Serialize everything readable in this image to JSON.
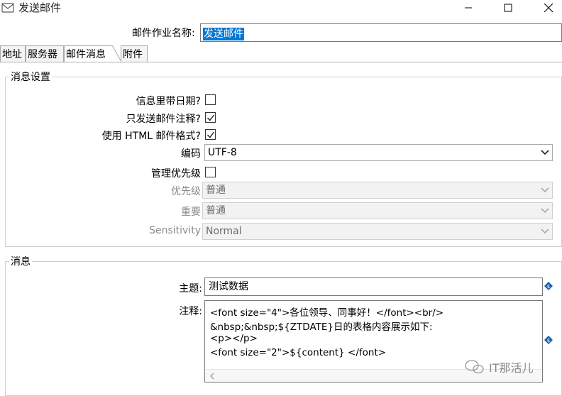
{
  "window": {
    "title": "发送邮件"
  },
  "job": {
    "label": "邮件作业名称:",
    "value": "发送邮件"
  },
  "tabs": [
    {
      "label": "地址"
    },
    {
      "label": "服务器"
    },
    {
      "label": "邮件消息"
    },
    {
      "label": "附件"
    }
  ],
  "message_settings": {
    "title": "消息设置",
    "date_in_message": {
      "label": "信息里带日期?",
      "checked": false
    },
    "only_comment": {
      "label": "只发送邮件注释?",
      "checked": true
    },
    "use_html": {
      "label": "使用 HTML 邮件格式?",
      "checked": true
    },
    "encoding": {
      "label": "编码",
      "value": "UTF-8"
    },
    "manage_priority": {
      "label": "管理优先级",
      "checked": false
    },
    "priority": {
      "label": "优先级",
      "value": "普通"
    },
    "importance": {
      "label": "重要",
      "value": "普通"
    },
    "sensitivity": {
      "label": "Sensitivity",
      "value": "Normal"
    }
  },
  "message": {
    "title": "消息",
    "subject": {
      "label": "主题:",
      "value": "测试数据"
    },
    "comment": {
      "label": "注释:",
      "lines": [
        "<font size=\"4\">各位领导、同事好！</font><br/>",
        "&nbsp;&nbsp;${ZTDATE}日的表格内容展示如下:",
        "<p></p>",
        "<font size=\"2\">${content} </font>"
      ]
    }
  },
  "watermark": {
    "text": "IT那活儿"
  },
  "colors": {
    "selection": "#0078d7",
    "variable_icon": "#1f5fa8"
  }
}
